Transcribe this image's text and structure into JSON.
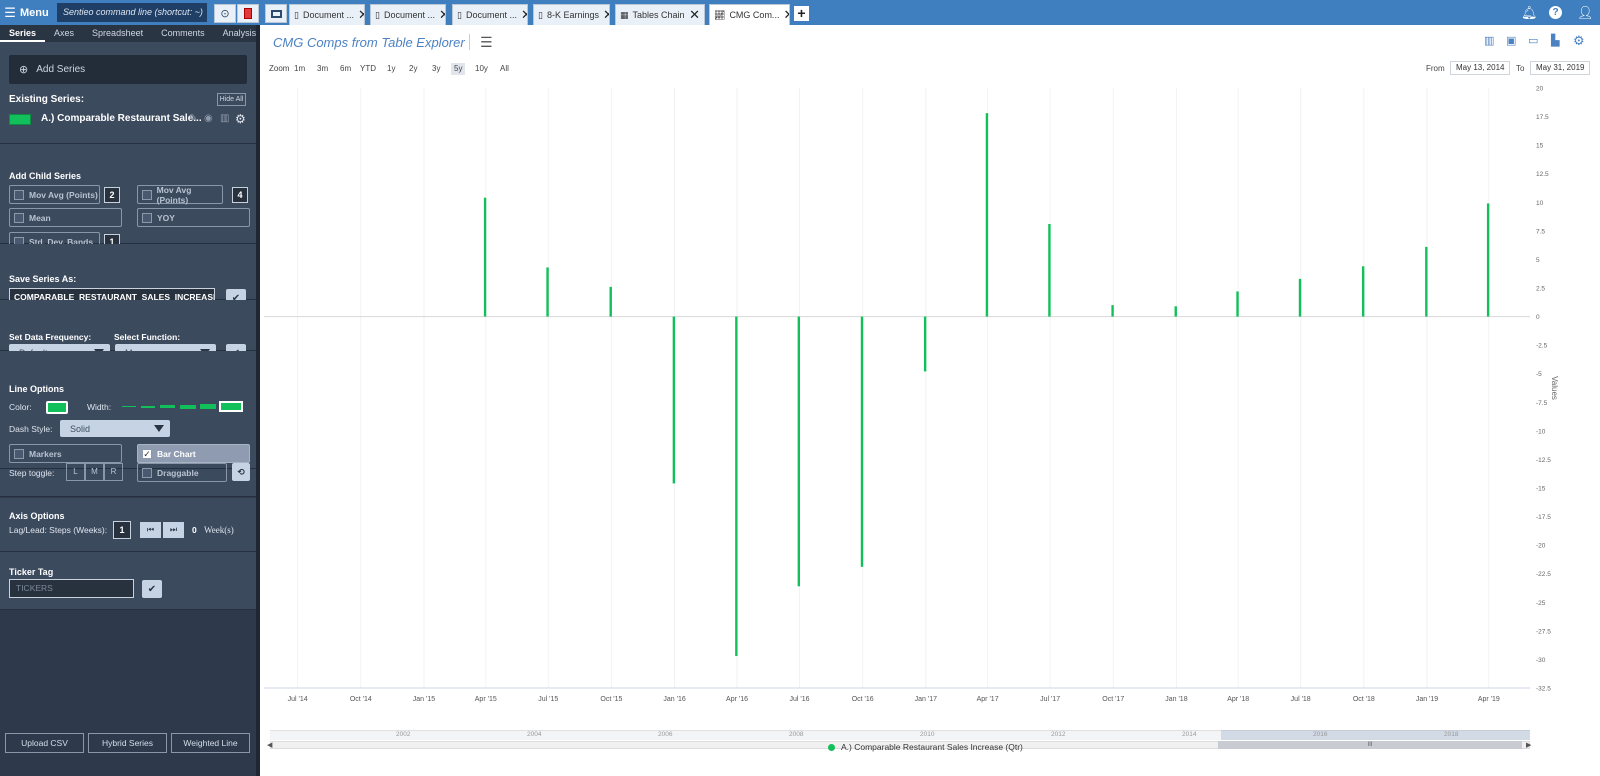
{
  "topbar": {
    "menu_label": "Menu",
    "command_placeholder": "Sentieo command line (shortcut: ~)",
    "tabs": [
      {
        "label": "Document ...",
        "icon": "document-icon"
      },
      {
        "label": "Document ...",
        "icon": "document-icon"
      },
      {
        "label": "Document ...",
        "icon": "document-icon"
      },
      {
        "label": "8-K Earnings",
        "icon": "document-icon"
      },
      {
        "label": "Tables Chain",
        "icon": "table-icon"
      },
      {
        "label": "CMG Com...",
        "icon": "chart-icon",
        "active": true
      }
    ],
    "close_glyph": "✕",
    "add_tab_glyph": "+"
  },
  "sidebar": {
    "tabs": [
      "Series",
      "Axes",
      "Spreadsheet",
      "Comments",
      "Analysis"
    ],
    "active_tab": "Series",
    "add_series_label": "Add Series",
    "existing_series_label": "Existing Series:",
    "hide_all_label": "Hide All",
    "series": [
      {
        "name": "A.) Comparable Restaurant Sale...",
        "color": "#11c05a"
      }
    ],
    "add_child": {
      "title": "Add Child Series",
      "options": [
        {
          "label": "Mov Avg (Points)",
          "value": "2"
        },
        {
          "label": "Mov Avg (Points)",
          "value": "4"
        },
        {
          "label": "Mean"
        },
        {
          "label": "YOY"
        },
        {
          "label": "Std. Dev. Bands",
          "value": "1"
        }
      ]
    },
    "save_series": {
      "title": "Save Series As:",
      "value": "COMPARABLE_RESTAURANT_SALES_INCREASE_"
    },
    "frequency": {
      "label": "Set Data Frequency:",
      "value": "Default",
      "function_label": "Select Function:",
      "function_value": "Mean"
    },
    "line_options": {
      "title": "Line Options",
      "color_label": "Color:",
      "width_label": "Width:",
      "dash_label": "Dash Style:",
      "dash_value": "Solid",
      "markers_label": "Markers",
      "bar_chart_label": "Bar Chart",
      "step_label": "Step toggle:",
      "steps": [
        "L",
        "M",
        "R"
      ],
      "draggable_label": "Draggable"
    },
    "axis_options": {
      "title": "Axis Options",
      "lag_label": "Lag/Lead: Steps (Weeks):",
      "lag_value": "1",
      "weeks_value": "0",
      "weeks_unit": "Week(s)"
    },
    "ticker_tag": {
      "title": "Ticker Tag",
      "placeholder": "TICKERS"
    },
    "bottom_buttons": [
      "Upload CSV",
      "Hybrid Series",
      "Weighted Line"
    ]
  },
  "main": {
    "title": "CMG Comps from Table Explorer",
    "zoom_label": "Zoom",
    "zoom_options": [
      "1m",
      "3m",
      "6m",
      "YTD",
      "1y",
      "2y",
      "3y",
      "5y",
      "10y",
      "All"
    ],
    "zoom_active": "5y",
    "from_label": "From",
    "from_date": "May 13, 2014",
    "to_label": "To",
    "to_date": "May 31, 2019",
    "navigator_years": [
      "2002",
      "2004",
      "2006",
      "2008",
      "2010",
      "2012",
      "2014",
      "2016",
      "2018"
    ],
    "navigator_handle_glyph": "lll"
  },
  "chart_data": {
    "type": "bar",
    "title": "",
    "ylabel": "Values",
    "ylim": [
      -32.5,
      20
    ],
    "yticks": [
      20,
      17.5,
      15,
      12.5,
      10,
      7.5,
      5,
      2.5,
      0,
      -2.5,
      -5,
      -7.5,
      -10,
      -12.5,
      -15,
      -17.5,
      -20,
      -22.5,
      -25,
      -27.5,
      -30,
      -32.5
    ],
    "x_tick_labels": [
      "Jul '14",
      "Oct '14",
      "Jan '15",
      "Apr '15",
      "Jul '15",
      "Oct '15",
      "Jan '16",
      "Apr '16",
      "Jul '16",
      "Oct '16",
      "Jan '17",
      "Apr '17",
      "Jul '17",
      "Oct '17",
      "Jan '18",
      "Apr '18",
      "Jul '18",
      "Oct '18",
      "Jan '19",
      "Apr '19"
    ],
    "x_range": [
      "2014-05-13",
      "2019-05-31"
    ],
    "series": [
      {
        "name": "A.) Comparable Restaurant Sales Increase (Qtr)",
        "color": "#11c05a",
        "points": [
          {
            "x": "2015-03-31",
            "y": 10.4
          },
          {
            "x": "2015-06-30",
            "y": 4.3
          },
          {
            "x": "2015-09-30",
            "y": 2.6
          },
          {
            "x": "2015-12-31",
            "y": -14.6
          },
          {
            "x": "2016-03-31",
            "y": -29.7
          },
          {
            "x": "2016-06-30",
            "y": -23.6
          },
          {
            "x": "2016-09-30",
            "y": -21.9
          },
          {
            "x": "2016-12-31",
            "y": -4.8
          },
          {
            "x": "2017-03-31",
            "y": 17.8
          },
          {
            "x": "2017-06-30",
            "y": 8.1
          },
          {
            "x": "2017-09-30",
            "y": 1.0
          },
          {
            "x": "2017-12-31",
            "y": 0.9
          },
          {
            "x": "2018-03-31",
            "y": 2.2
          },
          {
            "x": "2018-06-30",
            "y": 3.3
          },
          {
            "x": "2018-09-30",
            "y": 4.4
          },
          {
            "x": "2018-12-31",
            "y": 6.1
          },
          {
            "x": "2019-03-31",
            "y": 9.9
          }
        ]
      }
    ],
    "legend": "bottom-center",
    "grid": true
  }
}
